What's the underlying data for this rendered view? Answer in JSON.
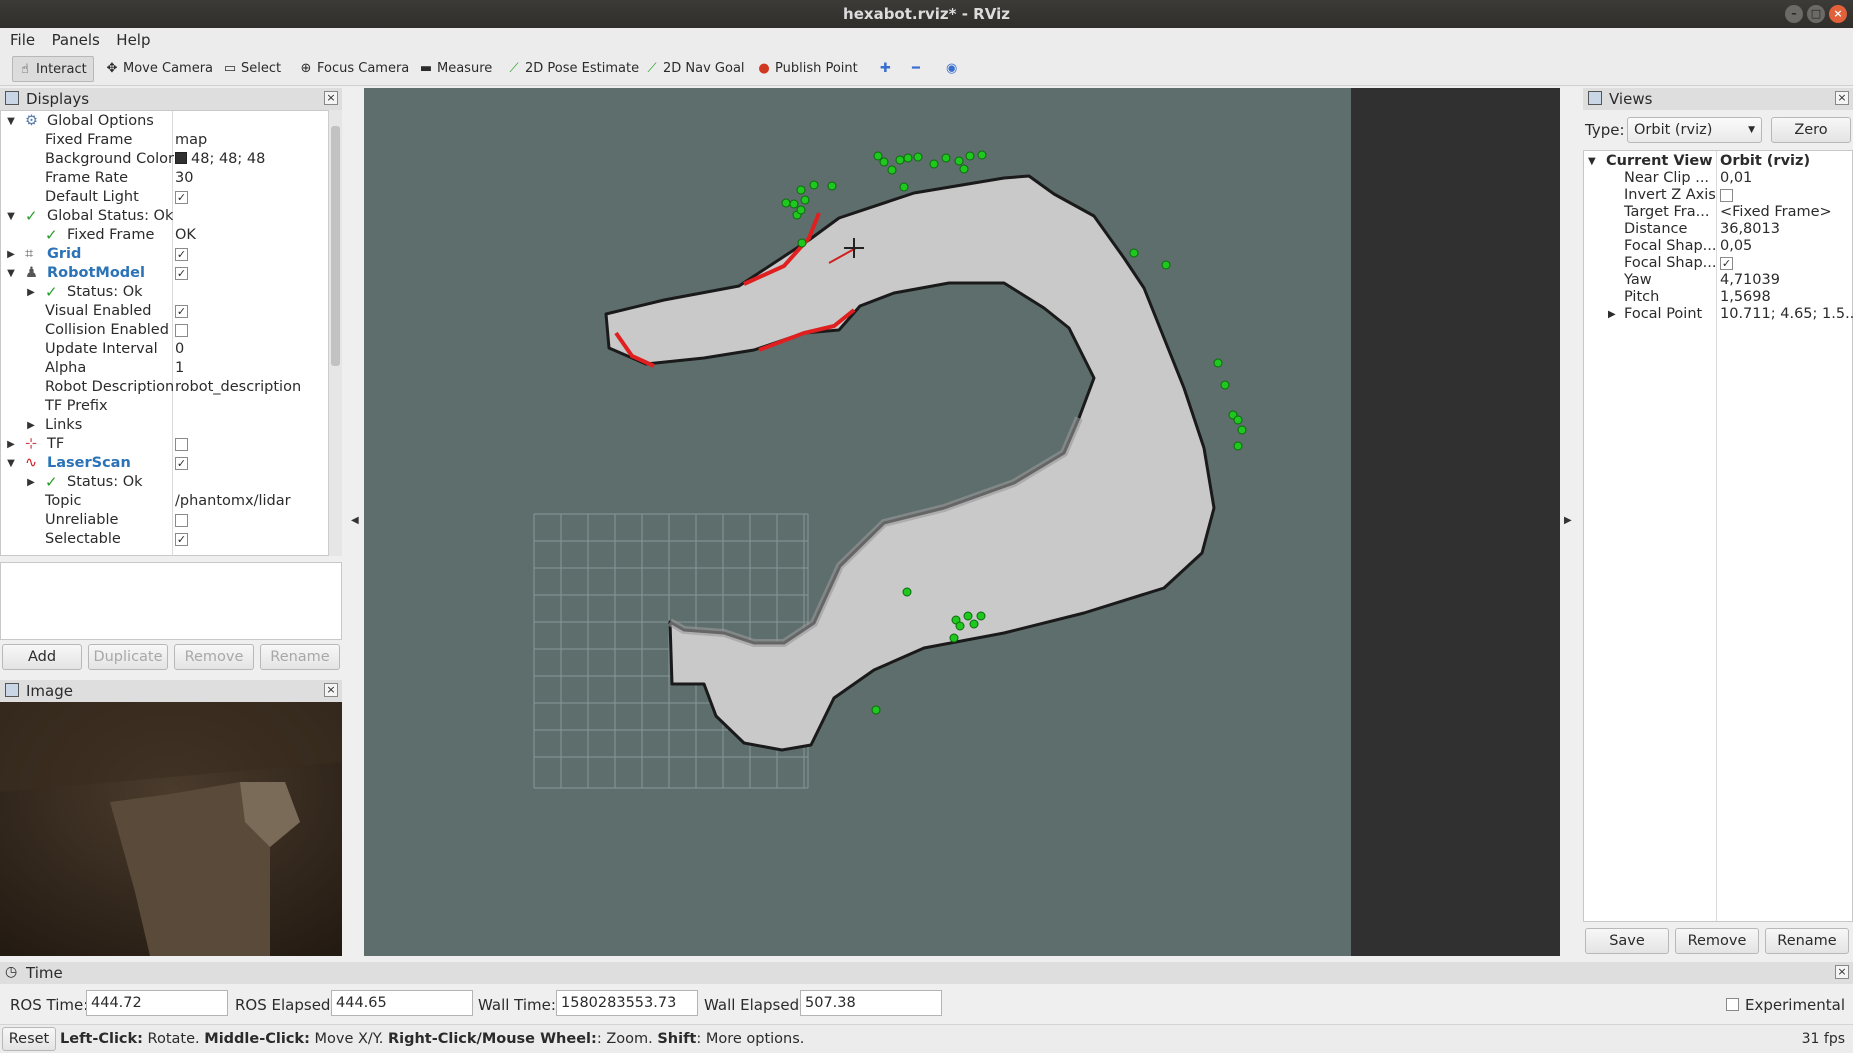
{
  "window": {
    "title": "hexabot.rviz* - RViz"
  },
  "menu": [
    "File",
    "Panels",
    "Help"
  ],
  "toolbar": {
    "interact": "Interact",
    "move_camera": "Move Camera",
    "select": "Select",
    "focus_camera": "Focus Camera",
    "measure": "Measure",
    "pose_estimate": "2D Pose Estimate",
    "nav_goal": "2D Nav Goal",
    "publish_point": "Publish Point"
  },
  "displays": {
    "title": "Displays",
    "rows": [
      {
        "label": "Global Options",
        "value": ""
      },
      {
        "label": "Fixed Frame",
        "value": "map"
      },
      {
        "label": "Background Color",
        "value": "48; 48; 48"
      },
      {
        "label": "Frame Rate",
        "value": "30"
      },
      {
        "label": "Default Light",
        "value": ""
      },
      {
        "label": "Global Status: Ok",
        "value": ""
      },
      {
        "label": "Fixed Frame",
        "value": "OK"
      },
      {
        "label": "Grid",
        "value": ""
      },
      {
        "label": "RobotModel",
        "value": ""
      },
      {
        "label": "Status: Ok",
        "value": ""
      },
      {
        "label": "Visual Enabled",
        "value": ""
      },
      {
        "label": "Collision Enabled",
        "value": ""
      },
      {
        "label": "Update Interval",
        "value": "0"
      },
      {
        "label": "Alpha",
        "value": "1"
      },
      {
        "label": "Robot Description",
        "value": "robot_description"
      },
      {
        "label": "TF Prefix",
        "value": ""
      },
      {
        "label": "Links",
        "value": ""
      },
      {
        "label": "TF",
        "value": ""
      },
      {
        "label": "LaserScan",
        "value": ""
      },
      {
        "label": "Status: Ok",
        "value": ""
      },
      {
        "label": "Topic",
        "value": "/phantomx/lidar"
      },
      {
        "label": "Unreliable",
        "value": ""
      },
      {
        "label": "Selectable",
        "value": ""
      }
    ],
    "buttons": {
      "add": "Add",
      "duplicate": "Duplicate",
      "remove": "Remove",
      "rename": "Rename"
    }
  },
  "image_panel": {
    "title": "Image"
  },
  "views": {
    "title": "Views",
    "type_label": "Type:",
    "type_value": "Orbit (rviz)",
    "zero": "Zero",
    "current_view_label": "Current View",
    "current_view_value": "Orbit (rviz)",
    "rows": [
      {
        "label": "Near Clip ...",
        "value": "0,01"
      },
      {
        "label": "Invert Z Axis",
        "value": ""
      },
      {
        "label": "Target Fra...",
        "value": "<Fixed Frame>"
      },
      {
        "label": "Distance",
        "value": "36,8013"
      },
      {
        "label": "Focal Shap...",
        "value": "0,05"
      },
      {
        "label": "Focal Shap...",
        "value": ""
      },
      {
        "label": "Yaw",
        "value": "4,71039"
      },
      {
        "label": "Pitch",
        "value": "1,5698"
      },
      {
        "label": "Focal Point",
        "value": "10.711; 4.65; 1.5..."
      }
    ],
    "buttons": {
      "save": "Save",
      "remove": "Remove",
      "rename": "Rename"
    }
  },
  "time": {
    "title": "Time",
    "ros_time_label": "ROS Time:",
    "ros_time": "444.72",
    "ros_elapsed_label": "ROS Elapsed:",
    "ros_elapsed": "444.65",
    "wall_time_label": "Wall Time:",
    "wall_time": "1580283553.73",
    "wall_elapsed_label": "Wall Elapsed:",
    "wall_elapsed": "507.38",
    "experimental": "Experimental"
  },
  "status": {
    "reset": "Reset",
    "left_click": "Left-Click:",
    "left_click_action": " Rotate. ",
    "middle_click": "Middle-Click:",
    "middle_click_action": " Move X/Y. ",
    "right_click": "Right-Click/Mouse Wheel:",
    "right_click_action": ": Zoom. ",
    "shift": "Shift",
    "shift_action": ": More options.",
    "fps": "31 fps"
  },
  "colors": {
    "view_background": "#5e6e6d",
    "map_free": "#c8c8c8",
    "laser_points": "#1ec81e",
    "scan_edge": "#e02020",
    "tree_link": "#2b73b6"
  }
}
